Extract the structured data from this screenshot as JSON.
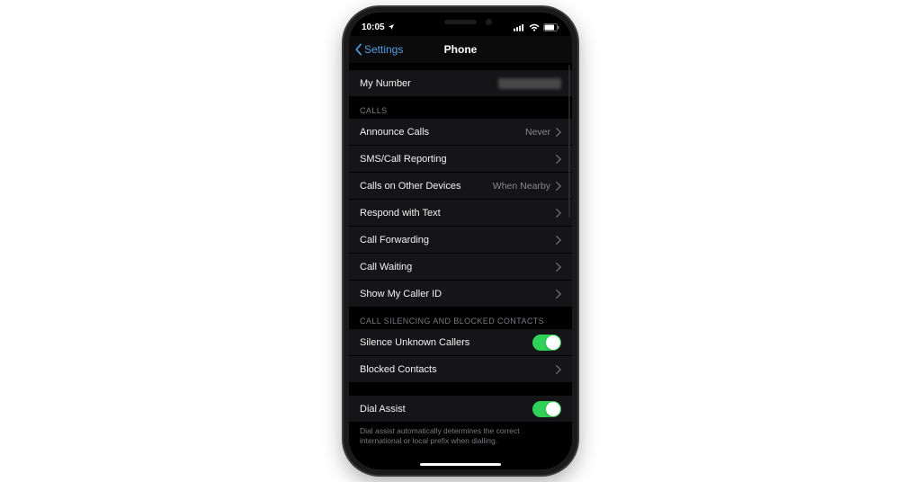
{
  "status": {
    "time": "10:05"
  },
  "nav": {
    "back_label": "Settings",
    "title": "Phone"
  },
  "my_number": {
    "label": "My Number"
  },
  "sections": {
    "calls_header": "CALLS",
    "silencing_header": "CALL SILENCING AND BLOCKED CONTACTS"
  },
  "rows": {
    "announce": {
      "label": "Announce Calls",
      "value": "Never"
    },
    "sms": {
      "label": "SMS/Call Reporting"
    },
    "other": {
      "label": "Calls on Other Devices",
      "value": "When Nearby"
    },
    "respond": {
      "label": "Respond with Text"
    },
    "forward": {
      "label": "Call Forwarding"
    },
    "waiting": {
      "label": "Call Waiting"
    },
    "callerid": {
      "label": "Show My Caller ID"
    },
    "silence": {
      "label": "Silence Unknown Callers"
    },
    "blocked": {
      "label": "Blocked Contacts"
    },
    "dialassist": {
      "label": "Dial Assist"
    }
  },
  "footer": {
    "dialassist": "Dial assist automatically determines the correct international or local prefix when dialling."
  }
}
